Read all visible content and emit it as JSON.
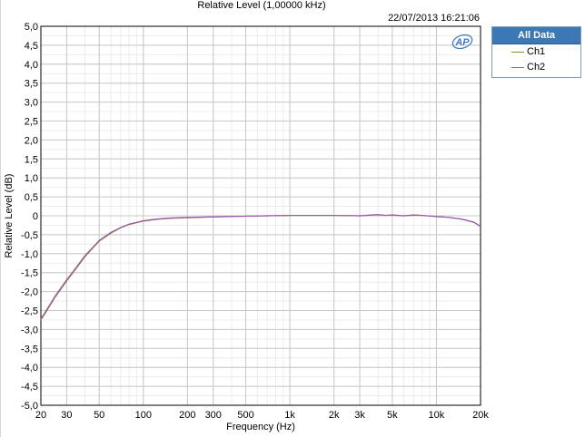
{
  "chart_data": {
    "type": "line",
    "title": "Relative Level (1,00000 kHz)",
    "timestamp": "22/07/2013 16:21:06",
    "xlabel": "Frequency (Hz)",
    "ylabel": "Relative Level (dB)",
    "x_scale": "log",
    "xlim": [
      20,
      20000
    ],
    "ylim": [
      -5,
      5
    ],
    "grid": true,
    "x_ticks": [
      {
        "v": 20,
        "label": "20"
      },
      {
        "v": 30,
        "label": "30"
      },
      {
        "v": 50,
        "label": "50"
      },
      {
        "v": 100,
        "label": "100"
      },
      {
        "v": 200,
        "label": "200"
      },
      {
        "v": 300,
        "label": "300"
      },
      {
        "v": 500,
        "label": "500"
      },
      {
        "v": 1000,
        "label": "1k"
      },
      {
        "v": 2000,
        "label": "2k"
      },
      {
        "v": 3000,
        "label": "3k"
      },
      {
        "v": 5000,
        "label": "5k"
      },
      {
        "v": 10000,
        "label": "10k"
      },
      {
        "v": 20000,
        "label": "20k"
      }
    ],
    "y_ticks": [
      {
        "v": 5,
        "label": "5,0"
      },
      {
        "v": 4.5,
        "label": "4,5"
      },
      {
        "v": 4,
        "label": "4,0"
      },
      {
        "v": 3.5,
        "label": "3,5"
      },
      {
        "v": 3,
        "label": "3,0"
      },
      {
        "v": 2.5,
        "label": "2,5"
      },
      {
        "v": 2,
        "label": "2,0"
      },
      {
        "v": 1.5,
        "label": "1,5"
      },
      {
        "v": 1,
        "label": "1,0"
      },
      {
        "v": 0.5,
        "label": "0,5"
      },
      {
        "v": 0,
        "label": "0"
      },
      {
        "v": -0.5,
        "label": "-0,5"
      },
      {
        "v": -1,
        "label": "-1,0"
      },
      {
        "v": -1.5,
        "label": "-1,5"
      },
      {
        "v": -2,
        "label": "-2,0"
      },
      {
        "v": -2.5,
        "label": "-2,5"
      },
      {
        "v": -3,
        "label": "-3,0"
      },
      {
        "v": -3.5,
        "label": "-3,5"
      },
      {
        "v": -4,
        "label": "-4,0"
      },
      {
        "v": -4.5,
        "label": "-4,5"
      },
      {
        "v": -5,
        "label": "-5,0"
      }
    ],
    "series": [
      {
        "name": "Ch1",
        "color": "#8c8c28",
        "points": [
          [
            20,
            -2.75
          ],
          [
            22,
            -2.5
          ],
          [
            25,
            -2.15
          ],
          [
            30,
            -1.72
          ],
          [
            35,
            -1.38
          ],
          [
            40,
            -1.08
          ],
          [
            45,
            -0.86
          ],
          [
            50,
            -0.67
          ],
          [
            60,
            -0.46
          ],
          [
            70,
            -0.32
          ],
          [
            80,
            -0.23
          ],
          [
            100,
            -0.14
          ],
          [
            120,
            -0.1
          ],
          [
            150,
            -0.07
          ],
          [
            200,
            -0.05
          ],
          [
            300,
            -0.03
          ],
          [
            500,
            -0.01
          ],
          [
            700,
            0
          ],
          [
            1000,
            0.01
          ],
          [
            2000,
            0.01
          ],
          [
            3000,
            0
          ],
          [
            4000,
            0.03
          ],
          [
            4500,
            0.01
          ],
          [
            5000,
            0.02
          ],
          [
            6000,
            0
          ],
          [
            7000,
            0.02
          ],
          [
            8000,
            0.01
          ],
          [
            10000,
            -0.02
          ],
          [
            12000,
            -0.04
          ],
          [
            15000,
            -0.09
          ],
          [
            18000,
            -0.17
          ],
          [
            20000,
            -0.28
          ]
        ]
      },
      {
        "name": "Ch2",
        "color": "#9b59b6",
        "points": [
          [
            20,
            -2.72
          ],
          [
            22,
            -2.47
          ],
          [
            25,
            -2.12
          ],
          [
            30,
            -1.69
          ],
          [
            35,
            -1.35
          ],
          [
            40,
            -1.05
          ],
          [
            45,
            -0.84
          ],
          [
            50,
            -0.65
          ],
          [
            60,
            -0.44
          ],
          [
            70,
            -0.31
          ],
          [
            80,
            -0.22
          ],
          [
            100,
            -0.13
          ],
          [
            120,
            -0.09
          ],
          [
            150,
            -0.06
          ],
          [
            200,
            -0.04
          ],
          [
            300,
            -0.03
          ],
          [
            500,
            -0.01
          ],
          [
            700,
            0
          ],
          [
            1000,
            0.01
          ],
          [
            2000,
            0.01
          ],
          [
            3000,
            0
          ],
          [
            4000,
            0.03
          ],
          [
            4500,
            0.01
          ],
          [
            5000,
            0.02
          ],
          [
            6000,
            0
          ],
          [
            7000,
            0.02
          ],
          [
            8000,
            0.01
          ],
          [
            10000,
            -0.02
          ],
          [
            12000,
            -0.04
          ],
          [
            15000,
            -0.09
          ],
          [
            18000,
            -0.17
          ],
          [
            20000,
            -0.28
          ]
        ]
      }
    ]
  },
  "legend": {
    "header": "All Data",
    "items": [
      {
        "label": "Ch1",
        "color": "#8c8c28"
      },
      {
        "label": "Ch2",
        "color": "#9b59b6"
      }
    ]
  },
  "logo": {
    "text": "AP",
    "icon": "ap-logo-icon",
    "color": "#3c78c8"
  }
}
